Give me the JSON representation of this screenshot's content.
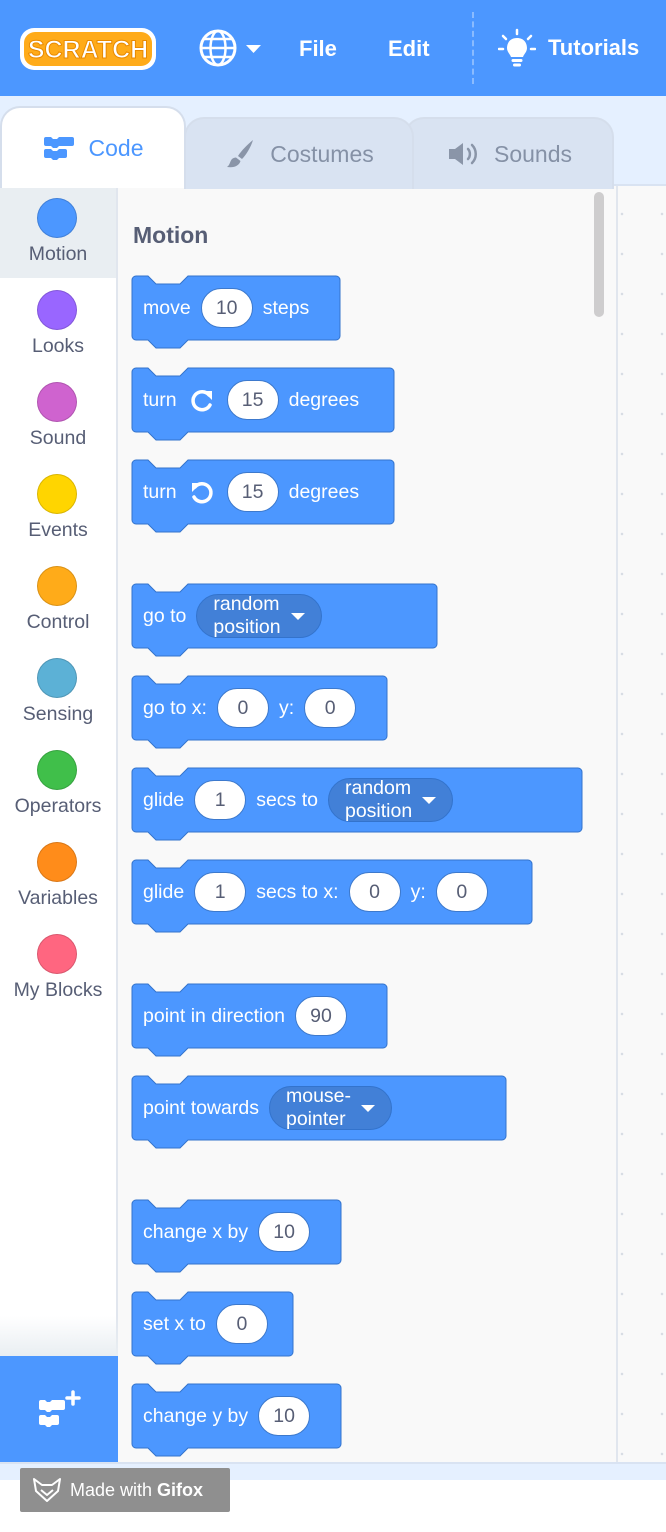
{
  "menubar": {
    "logo_text": "SCRATCH",
    "file_label": "File",
    "edit_label": "Edit",
    "tutorials_label": "Tutorials"
  },
  "tabs": {
    "code_label": "Code",
    "costumes_label": "Costumes",
    "sounds_label": "Sounds",
    "selected": "Code"
  },
  "categories": [
    {
      "label": "Motion",
      "color": "#4c97ff",
      "selected": true
    },
    {
      "label": "Looks",
      "color": "#9966ff"
    },
    {
      "label": "Sound",
      "color": "#cf63cf"
    },
    {
      "label": "Events",
      "color": "#ffd500"
    },
    {
      "label": "Control",
      "color": "#ffab19"
    },
    {
      "label": "Sensing",
      "color": "#5cb1d6"
    },
    {
      "label": "Operators",
      "color": "#40bf4a"
    },
    {
      "label": "Variables",
      "color": "#ff8c1a"
    },
    {
      "label": "My Blocks",
      "color": "#ff6680"
    }
  ],
  "flyout": {
    "title": "Motion",
    "block_color": "#4c97ff",
    "blocks": [
      {
        "parts": [
          "move",
          "10",
          "steps"
        ]
      },
      {
        "parts": [
          "turn",
          "rotate-right-icon",
          "15",
          "degrees"
        ]
      },
      {
        "parts": [
          "turn",
          "rotate-left-icon",
          "15",
          "degrees"
        ]
      },
      {
        "parts": [
          "go to",
          "random position"
        ]
      },
      {
        "parts": [
          "go to x:",
          "0",
          "y:",
          "0"
        ]
      },
      {
        "parts": [
          "glide",
          "1",
          "secs to",
          "random position"
        ]
      },
      {
        "parts": [
          "glide",
          "1",
          "secs to x:",
          "0",
          "y:",
          "0"
        ]
      },
      {
        "parts": [
          "point in direction",
          "90"
        ]
      },
      {
        "parts": [
          "point towards",
          "mouse-pointer"
        ]
      },
      {
        "parts": [
          "change x by",
          "10"
        ]
      },
      {
        "parts": [
          "set x to",
          "0"
        ]
      },
      {
        "parts": [
          "change y by",
          "10"
        ]
      }
    ]
  },
  "watermark": {
    "prefix": "Made with",
    "brand": "Gifox"
  }
}
